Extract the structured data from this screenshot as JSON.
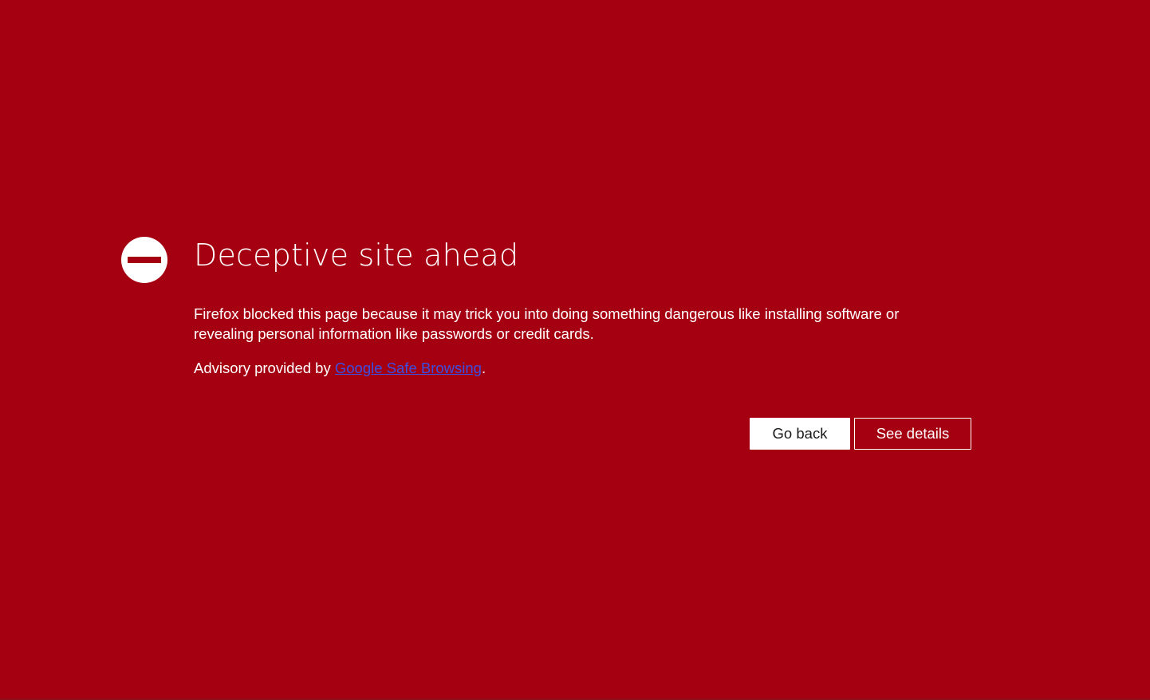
{
  "page": {
    "background_color": "#a50011",
    "accent_link_color": "#3c4fe0"
  },
  "warning": {
    "icon": "blocked-icon",
    "title": "Deceptive site ahead",
    "description": "Firefox blocked this page because it may trick you into doing something dangerous like installing software or revealing personal information like passwords or credit cards.",
    "advisory_prefix": "Advisory provided by ",
    "advisory_link": "Google Safe Browsing",
    "advisory_suffix": "."
  },
  "actions": {
    "go_back_label": "Go back",
    "see_details_label": "See details"
  }
}
